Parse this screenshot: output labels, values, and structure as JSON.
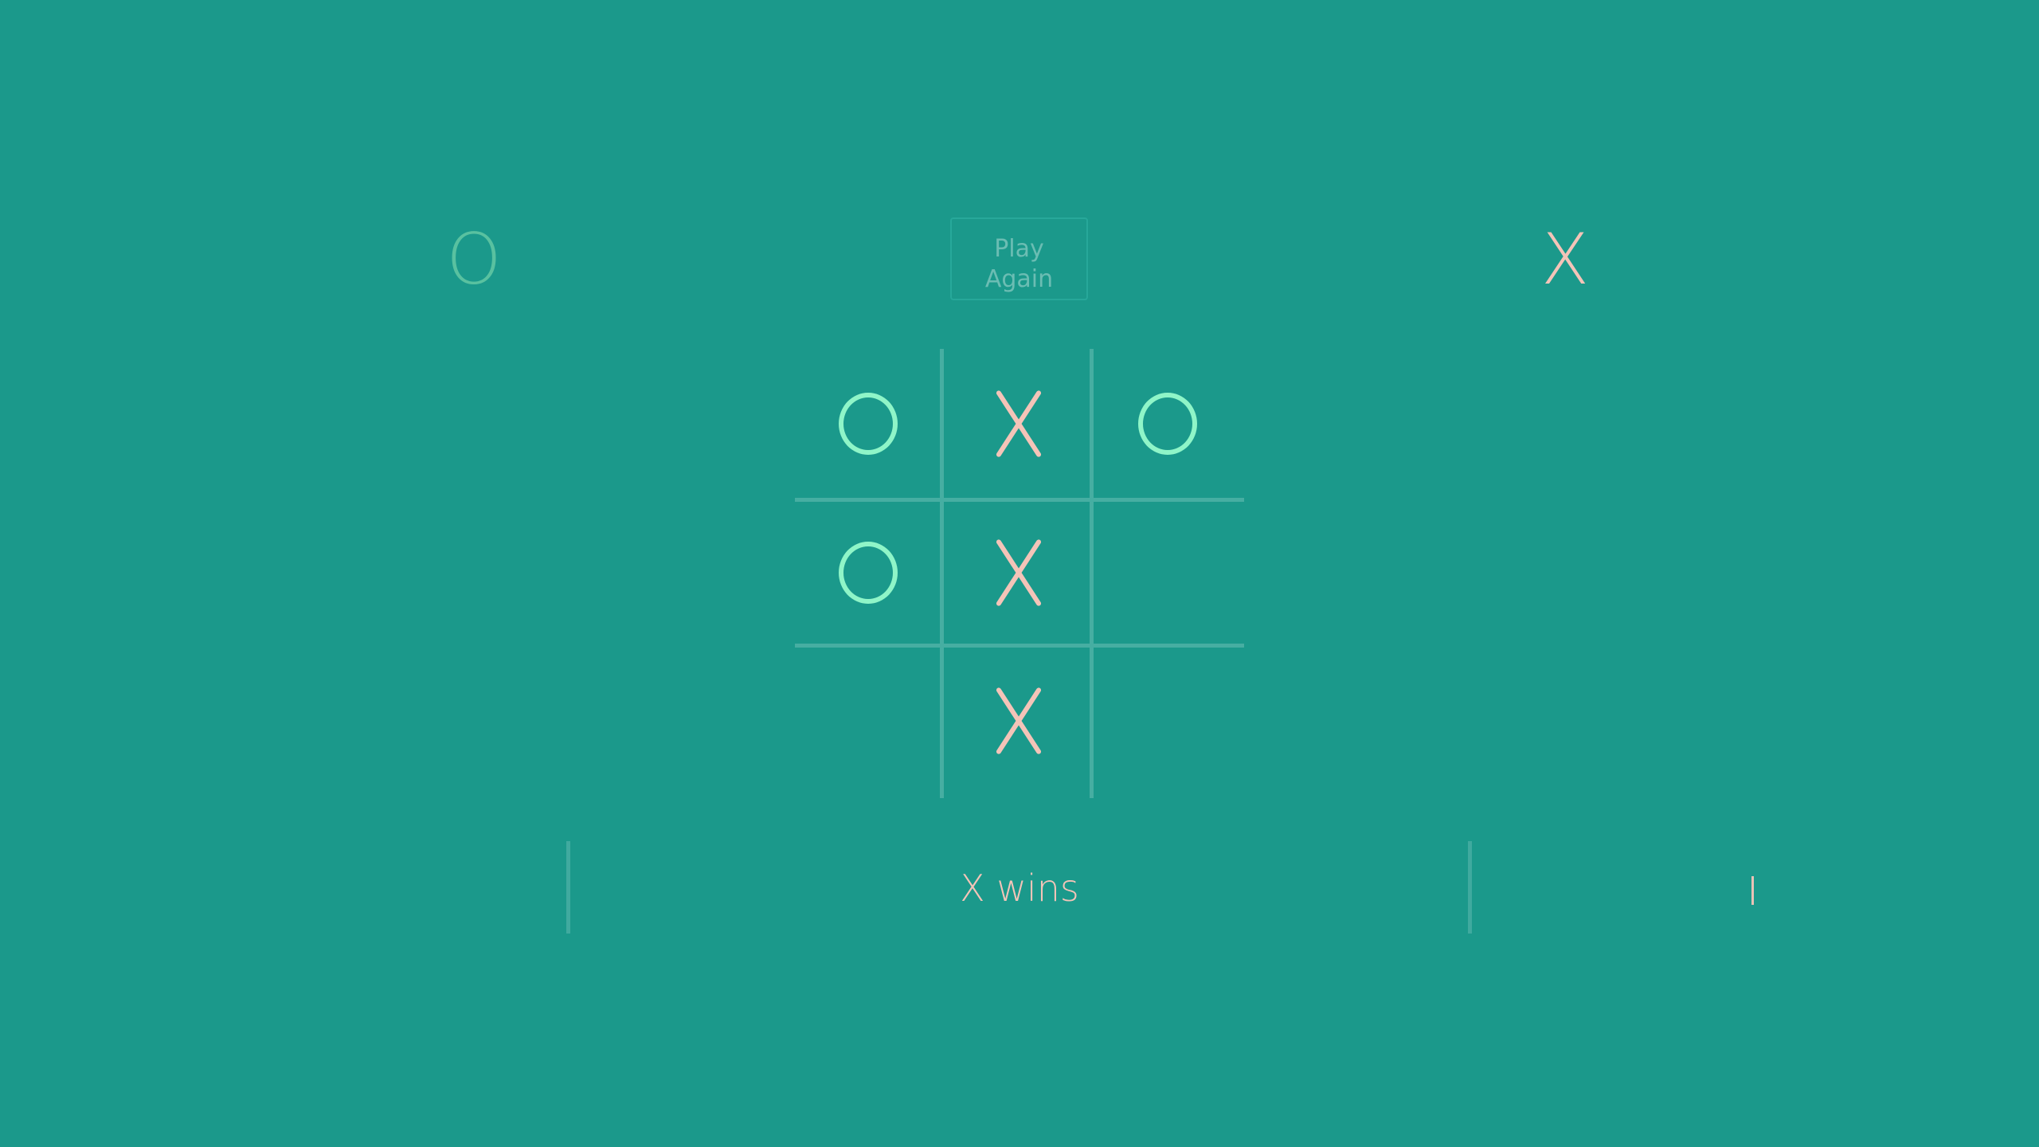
{
  "players": {
    "o_symbol": "O",
    "x_symbol": "X"
  },
  "controls": {
    "play_again_label": "Play Again"
  },
  "board": {
    "cells": [
      "O",
      "X",
      "O",
      "O",
      "X",
      "",
      "",
      "X",
      ""
    ]
  },
  "status": {
    "message": "X wins"
  },
  "colors": {
    "background": "#1b998b",
    "o_mark": "#8ff5c8",
    "x_mark": "#f4c4b8",
    "grid": "#46aea2"
  }
}
